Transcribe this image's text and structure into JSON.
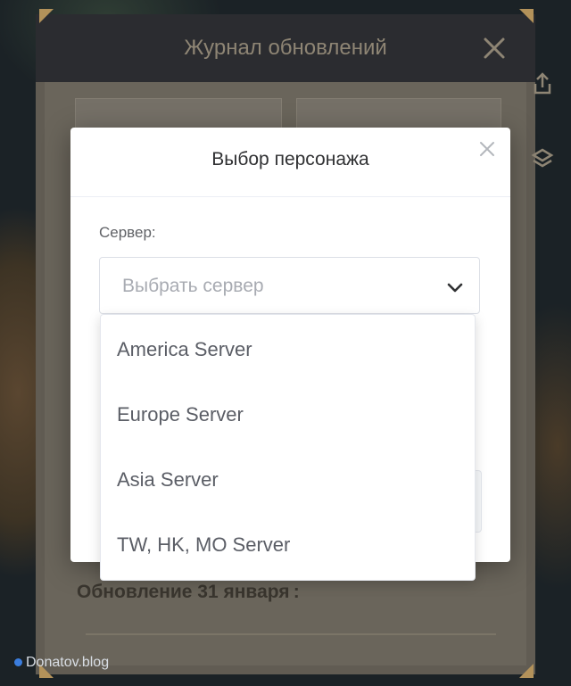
{
  "background_panel": {
    "title": "Журнал обновлений",
    "update_heading": "Обновление 31 января :"
  },
  "modal": {
    "title": "Выбор персонажа",
    "server_label": "Сервер:",
    "select_placeholder": "Выбрать сервер"
  },
  "dropdown": {
    "options": [
      "America Server",
      "Europe Server",
      "Asia Server",
      "TW, HK, MO Server"
    ]
  },
  "watermark": "Donatov.blog",
  "colors": {
    "panel_title": "#8e8574",
    "modal_bg": "#ffffff",
    "option_text": "#5b5e66",
    "placeholder": "#a8abb2"
  },
  "icons": [
    "close-icon",
    "chevron-down-icon",
    "share-icon",
    "layers-icon"
  ]
}
